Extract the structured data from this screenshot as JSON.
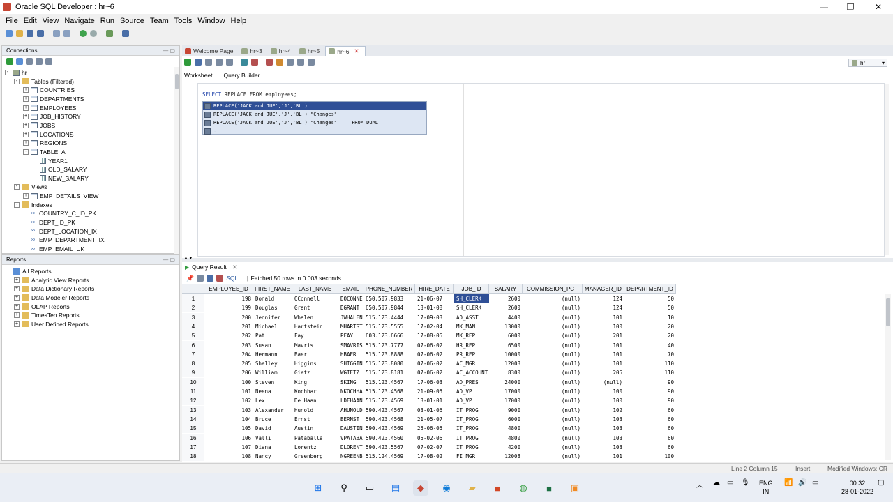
{
  "window": {
    "title": "Oracle SQL Developer : hr~6",
    "minimize": "—",
    "maximize": "❐",
    "close": "✕"
  },
  "menu": [
    "File",
    "Edit",
    "View",
    "Navigate",
    "Run",
    "Source",
    "Team",
    "Tools",
    "Window",
    "Help"
  ],
  "connections_panel": {
    "title": "Connections",
    "tree": [
      {
        "label": "hr",
        "kind": "db",
        "exp": "-",
        "indent": 0
      },
      {
        "label": "Tables (Filtered)",
        "kind": "folder",
        "exp": "-",
        "indent": 1
      },
      {
        "label": "COUNTRIES",
        "kind": "table",
        "exp": "+",
        "indent": 2
      },
      {
        "label": "DEPARTMENTS",
        "kind": "table",
        "exp": "+",
        "indent": 2
      },
      {
        "label": "EMPLOYEES",
        "kind": "table",
        "exp": "+",
        "indent": 2
      },
      {
        "label": "JOB_HISTORY",
        "kind": "table",
        "exp": "+",
        "indent": 2
      },
      {
        "label": "JOBS",
        "kind": "table",
        "exp": "+",
        "indent": 2
      },
      {
        "label": "LOCATIONS",
        "kind": "table",
        "exp": "+",
        "indent": 2
      },
      {
        "label": "REGIONS",
        "kind": "table",
        "exp": "+",
        "indent": 2
      },
      {
        "label": "TABLE_A",
        "kind": "table",
        "exp": "-",
        "indent": 2
      },
      {
        "label": "YEAR1",
        "kind": "column",
        "exp": "",
        "indent": 3
      },
      {
        "label": "OLD_SALARY",
        "kind": "column",
        "exp": "",
        "indent": 3
      },
      {
        "label": "NEW_SALARY",
        "kind": "column",
        "exp": "",
        "indent": 3
      },
      {
        "label": "Views",
        "kind": "folder",
        "exp": "-",
        "indent": 1
      },
      {
        "label": "EMP_DETAILS_VIEW",
        "kind": "table",
        "exp": "+",
        "indent": 2
      },
      {
        "label": "Indexes",
        "kind": "folder",
        "exp": "-",
        "indent": 1
      },
      {
        "label": "COUNTRY_C_ID_PK",
        "kind": "index",
        "exp": "",
        "indent": 2
      },
      {
        "label": "DEPT_ID_PK",
        "kind": "index",
        "exp": "",
        "indent": 2
      },
      {
        "label": "DEPT_LOCATION_IX",
        "kind": "index",
        "exp": "",
        "indent": 2
      },
      {
        "label": "EMP_DEPARTMENT_IX",
        "kind": "index",
        "exp": "",
        "indent": 2
      },
      {
        "label": "EMP_EMAIL_UK",
        "kind": "index",
        "exp": "",
        "indent": 2
      }
    ]
  },
  "reports_panel": {
    "title": "Reports",
    "items": [
      {
        "label": "All Reports",
        "exp": "",
        "indent": 0
      },
      {
        "label": "Analytic View Reports",
        "exp": "+",
        "indent": 1
      },
      {
        "label": "Data Dictionary Reports",
        "exp": "+",
        "indent": 1
      },
      {
        "label": "Data Modeler Reports",
        "exp": "+",
        "indent": 1
      },
      {
        "label": "OLAP Reports",
        "exp": "+",
        "indent": 1
      },
      {
        "label": "TimesTen Reports",
        "exp": "+",
        "indent": 1
      },
      {
        "label": "User Defined Reports",
        "exp": "+",
        "indent": 1
      }
    ]
  },
  "editor_tabs": [
    {
      "label": "Welcome Page",
      "active": false
    },
    {
      "label": "hr~3",
      "active": false
    },
    {
      "label": "hr~4",
      "active": false
    },
    {
      "label": "hr~5",
      "active": false
    },
    {
      "label": "hr~6",
      "active": true
    }
  ],
  "connection_selector": "hr",
  "worksheet_tabs": {
    "worksheet": "Worksheet",
    "query_builder": "Query Builder"
  },
  "editor": {
    "keyword": "SELECT",
    "rest": " REPLACE FROM employees;",
    "autocomplete": [
      "REPLACE('JACK and JUE','J','BL')",
      "REPLACE('JACK and JUE','J','BL') \"Changes\"",
      "REPLACE('JACK and JUE','J','BL') \"Changes\"     FROM DUAL",
      "..."
    ]
  },
  "results": {
    "tab_label": "Query Result",
    "sql_label": "SQL",
    "status": "Fetched 50 rows in 0.003 seconds",
    "columns": [
      "EMPLOYEE_ID",
      "FIRST_NAME",
      "LAST_NAME",
      "EMAIL",
      "PHONE_NUMBER",
      "HIRE_DATE",
      "JOB_ID",
      "SALARY",
      "COMMISSION_PCT",
      "MANAGER_ID",
      "DEPARTMENT_ID"
    ],
    "rows": [
      [
        "1",
        "198",
        "Donald",
        "OConnell",
        "DOCONNEL",
        "650.507.9833",
        "21-06-07",
        "SH_CLERK",
        "2600",
        "(null)",
        "124",
        "50"
      ],
      [
        "2",
        "199",
        "Douglas",
        "Grant",
        "DGRANT",
        "650.507.9844",
        "13-01-08",
        "SH_CLERK",
        "2600",
        "(null)",
        "124",
        "50"
      ],
      [
        "3",
        "200",
        "Jennifer",
        "Whalen",
        "JWHALEN",
        "515.123.4444",
        "17-09-03",
        "AD_ASST",
        "4400",
        "(null)",
        "101",
        "10"
      ],
      [
        "4",
        "201",
        "Michael",
        "Hartstein",
        "MHARTSTE",
        "515.123.5555",
        "17-02-04",
        "MK_MAN",
        "13000",
        "(null)",
        "100",
        "20"
      ],
      [
        "5",
        "202",
        "Pat",
        "Fay",
        "PFAY",
        "603.123.6666",
        "17-08-05",
        "MK_REP",
        "6000",
        "(null)",
        "201",
        "20"
      ],
      [
        "6",
        "203",
        "Susan",
        "Mavris",
        "SMAVRIS",
        "515.123.7777",
        "07-06-02",
        "HR_REP",
        "6500",
        "(null)",
        "101",
        "40"
      ],
      [
        "7",
        "204",
        "Hermann",
        "Baer",
        "HBAER",
        "515.123.8888",
        "07-06-02",
        "PR_REP",
        "10000",
        "(null)",
        "101",
        "70"
      ],
      [
        "8",
        "205",
        "Shelley",
        "Higgins",
        "SHIGGINS",
        "515.123.8080",
        "07-06-02",
        "AC_MGR",
        "12008",
        "(null)",
        "101",
        "110"
      ],
      [
        "9",
        "206",
        "William",
        "Gietz",
        "WGIETZ",
        "515.123.8181",
        "07-06-02",
        "AC_ACCOUNT",
        "8300",
        "(null)",
        "205",
        "110"
      ],
      [
        "10",
        "100",
        "Steven",
        "King",
        "SKING",
        "515.123.4567",
        "17-06-03",
        "AD_PRES",
        "24000",
        "(null)",
        "(null)",
        "90"
      ],
      [
        "11",
        "101",
        "Neena",
        "Kochhar",
        "NKOCHHAR",
        "515.123.4568",
        "21-09-05",
        "AD_VP",
        "17000",
        "(null)",
        "100",
        "90"
      ],
      [
        "12",
        "102",
        "Lex",
        "De Haan",
        "LDEHAAN",
        "515.123.4569",
        "13-01-01",
        "AD_VP",
        "17000",
        "(null)",
        "100",
        "90"
      ],
      [
        "13",
        "103",
        "Alexander",
        "Hunold",
        "AHUNOLD",
        "590.423.4567",
        "03-01-06",
        "IT_PROG",
        "9000",
        "(null)",
        "102",
        "60"
      ],
      [
        "14",
        "104",
        "Bruce",
        "Ernst",
        "BERNST",
        "590.423.4568",
        "21-05-07",
        "IT_PROG",
        "6000",
        "(null)",
        "103",
        "60"
      ],
      [
        "15",
        "105",
        "David",
        "Austin",
        "DAUSTIN",
        "590.423.4569",
        "25-06-05",
        "IT_PROG",
        "4800",
        "(null)",
        "103",
        "60"
      ],
      [
        "16",
        "106",
        "Valli",
        "Pataballa",
        "VPATABAL",
        "590.423.4560",
        "05-02-06",
        "IT_PROG",
        "4800",
        "(null)",
        "103",
        "60"
      ],
      [
        "17",
        "107",
        "Diana",
        "Lorentz",
        "DLORENTZ",
        "590.423.5567",
        "07-02-07",
        "IT_PROG",
        "4200",
        "(null)",
        "103",
        "60"
      ],
      [
        "18",
        "108",
        "Nancy",
        "Greenberg",
        "NGREENBE",
        "515.124.4569",
        "17-08-02",
        "FI_MGR",
        "12008",
        "(null)",
        "101",
        "100"
      ]
    ]
  },
  "statusbar": {
    "position": "Line 2 Column 15",
    "mode": "Insert",
    "info": "Modified Windows: CR"
  },
  "taskbar": {
    "lang": "ENG",
    "region": "IN",
    "time": "00:32",
    "date": "28-01-2022"
  }
}
